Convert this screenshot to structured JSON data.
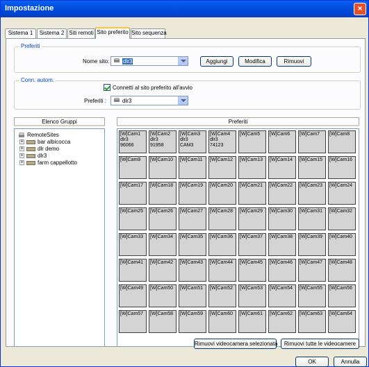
{
  "window": {
    "title": "Impostazione",
    "close_glyph": "×"
  },
  "tabs": [
    "Sistema 1",
    "Sistema 2",
    "Siti remoti",
    "Sito preferito",
    "Sito sequenza"
  ],
  "preferiti_group": {
    "legend": "Preferiti",
    "site_label": "Nome sito:",
    "site_value": "dlr3",
    "add": "Aggiungi",
    "edit": "Modifica",
    "remove": "Rimuovi"
  },
  "conn_group": {
    "legend": "Conn. autom.",
    "checkbox_label": "Connetti al sito preferito all'avvio",
    "checkbox_checked": true,
    "pref_label": "Preferiti :",
    "pref_value": "dlr3"
  },
  "left_header": "Elenco Gruppi",
  "right_header": "Preferiti",
  "tree": {
    "root": "RemoteSites",
    "items": [
      "bar albicocca",
      "dlr demo",
      "dlr3",
      "farm cappellotto"
    ]
  },
  "cameras": [
    "[W]Cam1\ndlr3\n96066",
    "[W]Cam2\ndlr3\n91958",
    "[W]Cam3\ndlr3\nCAM3",
    "[W]Cam4\ndlr3\n74123",
    "[W]Cam5",
    "[W]Cam6",
    "[W]Cam7",
    "[W]Cam8",
    "[W]Cam9",
    "[W]Cam10",
    "[W]Cam11",
    "[W]Cam12",
    "[W]Cam13",
    "[W]Cam14",
    "[W]Cam15",
    "[W]Cam16",
    "[W]Cam17",
    "[W]Cam18",
    "[W]Cam19",
    "[W]Cam20",
    "[W]Cam21",
    "[W]Cam22",
    "[W]Cam23",
    "[W]Cam24",
    "[W]Cam25",
    "[W]Cam26",
    "[W]Cam27",
    "[W]Cam28",
    "[W]Cam29",
    "[W]Cam30",
    "[W]Cam31",
    "[W]Cam32",
    "[W]Cam33",
    "[W]Cam34",
    "[W]Cam35",
    "[W]Cam36",
    "[W]Cam37",
    "[W]Cam38",
    "[W]Cam39",
    "[W]Cam40",
    "[W]Cam41",
    "[W]Cam42",
    "[W]Cam43",
    "[W]Cam44",
    "[W]Cam45",
    "[W]Cam46",
    "[W]Cam47",
    "[W]Cam48",
    "[W]Cam49",
    "[W]Cam50",
    "[W]Cam51",
    "[W]Cam52",
    "[W]Cam53",
    "[W]Cam54",
    "[W]Cam55",
    "[W]Cam56",
    "[W]Cam57",
    "[W]Cam58",
    "[W]Cam59",
    "[W]Cam60",
    "[W]Cam61",
    "[W]Cam62",
    "[W]Cam63",
    "[W]Cam64"
  ],
  "buttons": {
    "remove_selected": "Rimuovi videocamera selezionata",
    "remove_all": "Rimuovi tutte le videocamere",
    "ok": "OK",
    "cancel": "Annulla"
  }
}
